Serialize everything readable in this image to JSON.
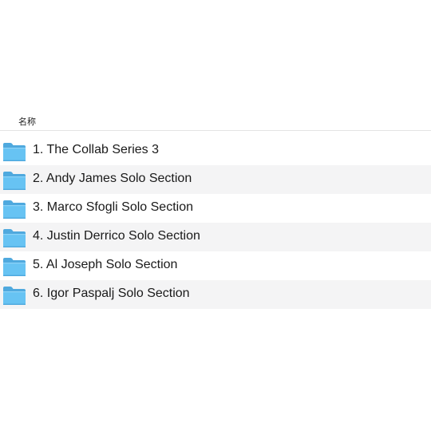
{
  "list": {
    "column_header": "名称",
    "items": [
      {
        "label": "1. The Collab Series 3",
        "icon": "folder-icon"
      },
      {
        "label": "2. Andy James Solo Section",
        "icon": "folder-icon"
      },
      {
        "label": "3. Marco Sfogli Solo Section",
        "icon": "folder-icon"
      },
      {
        "label": "4. Justin Derrico Solo Section",
        "icon": "folder-icon"
      },
      {
        "label": "5. Al Joseph Solo Section",
        "icon": "folder-icon"
      },
      {
        "label": "6. Igor Paspalj Solo Section",
        "icon": "folder-icon"
      }
    ]
  },
  "colors": {
    "folder_body": "#67c3f3",
    "folder_tab": "#4fa9de",
    "row_alt_background": "#f4f4f5"
  }
}
